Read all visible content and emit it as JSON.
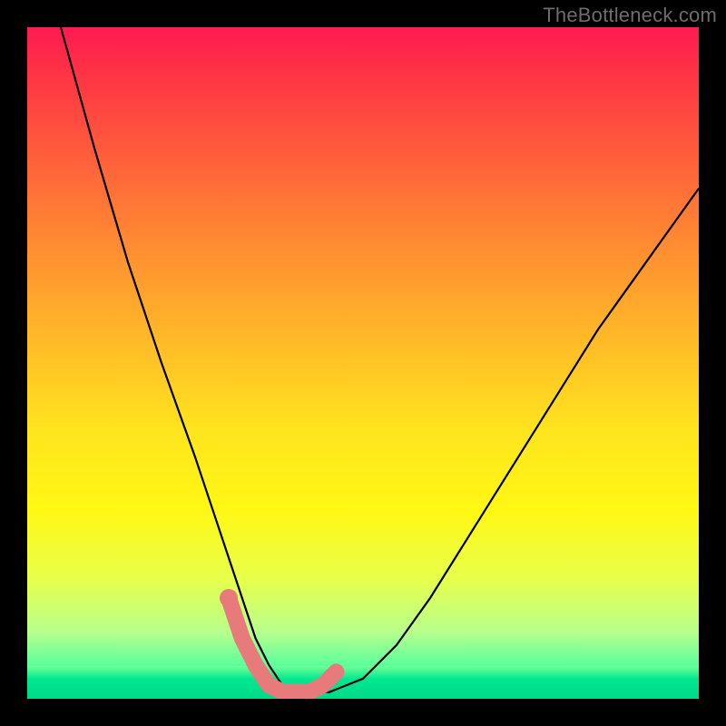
{
  "watermark": "TheBottleneck.com",
  "chart_data": {
    "type": "line",
    "title": "",
    "xlabel": "",
    "ylabel": "",
    "xlim": [
      0,
      100
    ],
    "ylim": [
      0,
      100
    ],
    "grid": false,
    "legend": false,
    "background": {
      "gradient_stops": [
        {
          "pos": 0,
          "color": "#ff1a52"
        },
        {
          "pos": 18,
          "color": "#ff5a3c"
        },
        {
          "pos": 46,
          "color": "#ffb828"
        },
        {
          "pos": 72,
          "color": "#fff814"
        },
        {
          "pos": 90,
          "color": "#b8ff8c"
        },
        {
          "pos": 100,
          "color": "#00f39a"
        }
      ]
    },
    "series": [
      {
        "name": "bottleneck-curve",
        "stroke": "#000000",
        "x": [
          5,
          10,
          15,
          20,
          25,
          28,
          30,
          32,
          34,
          36,
          38,
          40,
          45,
          50,
          55,
          60,
          65,
          70,
          75,
          80,
          85,
          90,
          95,
          100
        ],
        "y": [
          100,
          82,
          65,
          50,
          36,
          27,
          21,
          15,
          9,
          5,
          2,
          1,
          1,
          3,
          8,
          15,
          23,
          31,
          39,
          47,
          55,
          62,
          69,
          76
        ]
      }
    ],
    "highlight": {
      "name": "optimal-range-marker",
      "color": "#e77a7a",
      "x": [
        30,
        32,
        34,
        36,
        38,
        40,
        42,
        44,
        46
      ],
      "y": [
        15,
        9,
        5,
        2,
        1,
        1,
        1,
        2,
        4
      ]
    }
  }
}
